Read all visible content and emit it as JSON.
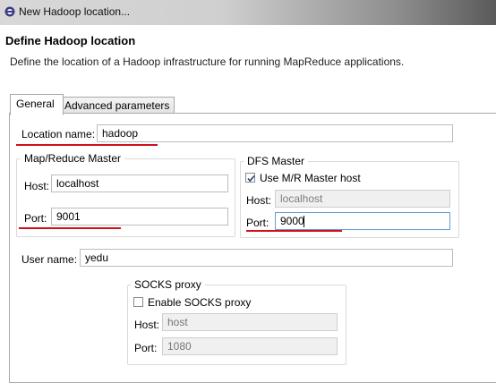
{
  "window": {
    "title": "New Hadoop location..."
  },
  "header": {
    "title": "Define Hadoop location",
    "description": "Define the location of a Hadoop infrastructure for running MapReduce applications."
  },
  "tabs": [
    {
      "label": "General",
      "selected": true
    },
    {
      "label": "Advanced parameters",
      "selected": false
    }
  ],
  "general": {
    "location_name_label": "Location name:",
    "location_name_value": "hadoop",
    "mr_master": {
      "title": "Map/Reduce Master",
      "host_label": "Host:",
      "host_value": "localhost",
      "port_label": "Port:",
      "port_value": "9001"
    },
    "dfs_master": {
      "title": "DFS Master",
      "use_mr_label": "Use M/R Master host",
      "use_mr_checked": true,
      "host_label": "Host:",
      "host_value": "localhost",
      "port_label": "Port:",
      "port_value": "9000"
    },
    "user_name_label": "User name:",
    "user_name_value": "yedu",
    "socks": {
      "title": "SOCKS proxy",
      "enable_label": "Enable SOCKS proxy",
      "enable_checked": false,
      "host_label": "Host:",
      "host_placeholder": "host",
      "port_label": "Port:",
      "port_placeholder": "1080"
    }
  },
  "colors": {
    "annotation_underline": "#d0101a",
    "focus_border": "#6a9ad6",
    "disabled_text": "#7d7d7d"
  }
}
